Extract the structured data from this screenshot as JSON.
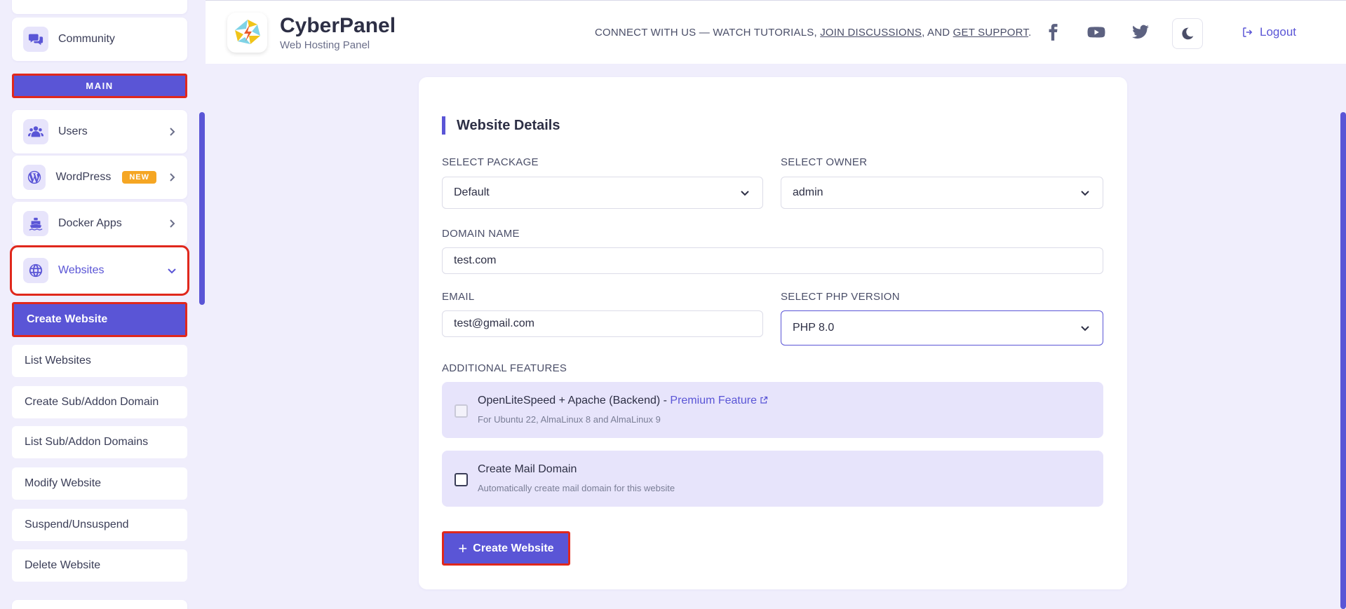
{
  "sidebar": {
    "community": "Community",
    "main_label": "MAIN",
    "items": [
      {
        "label": "Users",
        "icon": "users-icon"
      },
      {
        "label": "WordPress",
        "icon": "wordpress-icon",
        "badge": "NEW"
      },
      {
        "label": "Docker Apps",
        "icon": "docker-icon"
      },
      {
        "label": "Websites",
        "icon": "globe-icon"
      }
    ],
    "sub_items": [
      "Create Website",
      "List Websites",
      "Create Sub/Addon Domain",
      "List Sub/Addon Domains",
      "Modify Website",
      "Suspend/Unsuspend",
      "Delete Website"
    ]
  },
  "header": {
    "brand_title": "CyberPanel",
    "brand_subtitle": "Web Hosting Panel",
    "connect_prefix": "CONNECT WITH US — WATCH TUTORIALS, ",
    "join_link": "JOIN DISCUSSIONS",
    "connect_mid": ", AND ",
    "support_link": "GET SUPPORT",
    "connect_suffix": ".",
    "logout": "Logout"
  },
  "form": {
    "title": "Website Details",
    "package_label": "SELECT PACKAGE",
    "package_value": "Default",
    "owner_label": "SELECT OWNER",
    "owner_value": "admin",
    "domain_label": "DOMAIN NAME",
    "domain_value": "test.com",
    "email_label": "EMAIL",
    "email_value": "test@gmail.com",
    "php_label": "SELECT PHP VERSION",
    "php_value": "PHP 8.0",
    "features_label": "ADDITIONAL FEATURES",
    "feature1_title": "OpenLiteSpeed + Apache (Backend) - ",
    "feature1_premium": "Premium Feature",
    "feature1_sub": "For Ubuntu 22, AlmaLinux 8 and AlmaLinux 9",
    "feature2_title": "Create Mail Domain",
    "feature2_sub": "Automatically create mail domain for this website",
    "submit": "Create Website"
  },
  "colors": {
    "accent": "#5a55d6",
    "highlight": "#e0281c",
    "badge": "#f5a623",
    "background": "#f0eefc"
  }
}
